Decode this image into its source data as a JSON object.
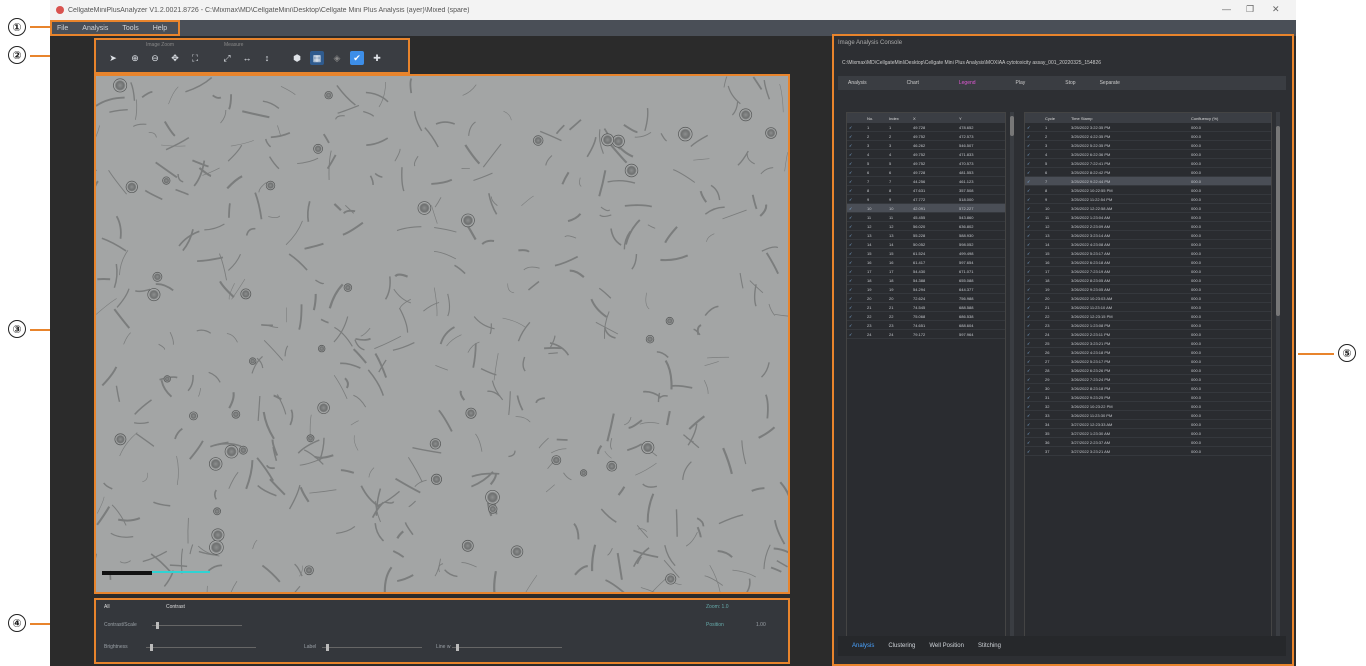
{
  "callouts": [
    "①",
    "②",
    "③",
    "④",
    "⑤"
  ],
  "window": {
    "title": "CellgateMiniPlusAnalyzer V1.2.0021.8726 - C:\\Mixmax\\MD\\CellgateMini\\Desktop\\Cellgate Mini Plus Analysis (ayer)\\Mixed (spare)",
    "minimize": "—",
    "maximize": "❐",
    "close": "✕"
  },
  "menu": [
    "File",
    "Analysis",
    "Tools",
    "Help"
  ],
  "toolbar": {
    "group_view": "Image Zoom",
    "group_measure": "Measure"
  },
  "image": {
    "description_icon": "image-icon"
  },
  "bottom": {
    "tab_all": "All",
    "tab_contrast": "Contrast",
    "label_contrast": "Contrast/Scale",
    "label_brightness": "Brightness",
    "label_label": "Label",
    "label_line": "Line w",
    "readout_right": "Zoom: 1.0",
    "readout_right2": "Position",
    "readout_right3": "1.00"
  },
  "right_panel": {
    "title": "Image Analysis Console",
    "path": "C:\\Mixmax\\MD\\CellgateMini\\Desktop\\Cellgate Mini Plus Analysis\\MOXIAA cytotoxicity assay_001_20220325_154826",
    "toolbar": [
      "Analysis",
      "Chart",
      "Legend",
      "Play",
      "Stop",
      "Separate"
    ],
    "left_grid": {
      "headers": [
        "",
        "No.",
        "Index",
        "X",
        "Y"
      ],
      "rows": [
        [
          "1",
          "1",
          "49.728",
          "478.652"
        ],
        [
          "2",
          "2",
          "49.752",
          "472.573"
        ],
        [
          "3",
          "3",
          "46.262",
          "546.507"
        ],
        [
          "4",
          "4",
          "49.752",
          "471.833"
        ],
        [
          "5",
          "5",
          "49.752",
          "470.573"
        ],
        [
          "6",
          "6",
          "49.728",
          "481.553"
        ],
        [
          "7",
          "7",
          "44.256",
          "461.123"
        ],
        [
          "8",
          "8",
          "47.631",
          "357.508"
        ],
        [
          "9",
          "9",
          "47.772",
          "518.000"
        ],
        [
          "10",
          "10",
          "42.091",
          "572.227"
        ],
        [
          "11",
          "11",
          "45.455",
          "543.860"
        ],
        [
          "12",
          "12",
          "56.020",
          "636.802"
        ],
        [
          "13",
          "13",
          "55.228",
          "588.930"
        ],
        [
          "14",
          "14",
          "50.052",
          "598.052"
        ],
        [
          "15",
          "15",
          "61.524",
          "499.498"
        ],
        [
          "16",
          "16",
          "61.417",
          "597.654"
        ],
        [
          "17",
          "17",
          "54.430",
          "671.071"
        ],
        [
          "18",
          "18",
          "54.388",
          "655.088"
        ],
        [
          "19",
          "19",
          "54.294",
          "644.377"
        ],
        [
          "20",
          "20",
          "72.624",
          "756.988"
        ],
        [
          "21",
          "21",
          "74.545",
          "688.588"
        ],
        [
          "22",
          "22",
          "75.068",
          "686.538"
        ],
        [
          "23",
          "23",
          "74.651",
          "688.604"
        ],
        [
          "24",
          "24",
          "79.172",
          "597.964"
        ]
      ]
    },
    "right_grid": {
      "headers": [
        "",
        "Cycle",
        "Time Stamp",
        "Confluency (%)"
      ],
      "rows": [
        [
          "1",
          "3/25/2022 3:22:35 PM",
          "000.0"
        ],
        [
          "2",
          "3/25/2022 4:22:35 PM",
          "000.0"
        ],
        [
          "3",
          "3/25/2022 5:22:35 PM",
          "000.0"
        ],
        [
          "4",
          "3/25/2022 6:22:36 PM",
          "000.0"
        ],
        [
          "5",
          "3/25/2022 7:22:41 PM",
          "000.0"
        ],
        [
          "6",
          "3/25/2022 8:22:42 PM",
          "000.0"
        ],
        [
          "7",
          "3/25/2022 9:22:44 PM",
          "000.0"
        ],
        [
          "8",
          "3/25/2022 10:22:55 PM",
          "000.0"
        ],
        [
          "9",
          "3/25/2022 11:22:54 PM",
          "000.0"
        ],
        [
          "10",
          "3/26/2022 12:22:58 AM",
          "000.0"
        ],
        [
          "11",
          "3/26/2022 1:23:04 AM",
          "000.0"
        ],
        [
          "12",
          "3/26/2022 2:23:09 AM",
          "000.0"
        ],
        [
          "13",
          "3/26/2022 3:23:14 AM",
          "000.0"
        ],
        [
          "14",
          "3/26/2022 4:23:08 AM",
          "000.0"
        ],
        [
          "15",
          "3/26/2022 5:23:17 AM",
          "000.0"
        ],
        [
          "16",
          "3/26/2022 6:23:18 AM",
          "000.0"
        ],
        [
          "17",
          "3/26/2022 7:23:19 AM",
          "000.0"
        ],
        [
          "18",
          "3/26/2022 8:23:05 AM",
          "000.0"
        ],
        [
          "19",
          "3/26/2022 9:23:05 AM",
          "000.0"
        ],
        [
          "20",
          "3/26/2022 10:23:03 AM",
          "000.0"
        ],
        [
          "21",
          "3/26/2022 11:23:10 AM",
          "000.0"
        ],
        [
          "22",
          "3/26/2022 12:23:15 PM",
          "000.0"
        ],
        [
          "23",
          "3/26/2022 1:23:08 PM",
          "000.0"
        ],
        [
          "24",
          "3/26/2022 2:23:11 PM",
          "000.0"
        ],
        [
          "25",
          "3/26/2022 3:23:21 PM",
          "000.0"
        ],
        [
          "26",
          "3/26/2022 4:23:18 PM",
          "000.0"
        ],
        [
          "27",
          "3/26/2022 5:23:17 PM",
          "000.0"
        ],
        [
          "28",
          "3/26/2022 6:23:26 PM",
          "000.0"
        ],
        [
          "29",
          "3/26/2022 7:23:24 PM",
          "000.0"
        ],
        [
          "30",
          "3/26/2022 8:23:18 PM",
          "000.0"
        ],
        [
          "31",
          "3/26/2022 9:23:25 PM",
          "000.0"
        ],
        [
          "32",
          "3/26/2022 10:23:22 PM",
          "000.0"
        ],
        [
          "33",
          "3/26/2022 11:23:30 PM",
          "000.0"
        ],
        [
          "34",
          "3/27/2022 12:23:33 AM",
          "000.0"
        ],
        [
          "35",
          "3/27/2022 1:23:30 AM",
          "000.0"
        ],
        [
          "36",
          "3/27/2022 2:23:37 AM",
          "000.0"
        ],
        [
          "37",
          "3/27/2022 3:23:21 AM",
          "000.0"
        ]
      ]
    },
    "tabs": [
      "Analysis",
      "Clustering",
      "Well Position",
      "Stitching"
    ]
  },
  "colors": {
    "accent": "#e8842c",
    "selected": "#3d8ee8",
    "pink": "#e058d5"
  }
}
